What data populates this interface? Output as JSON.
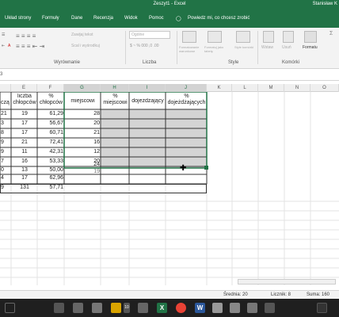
{
  "window": {
    "title": "Zeszyt1  -  Excel",
    "user": "Stanisław K"
  },
  "tabs": [
    "Układ strony",
    "Formuły",
    "Dane",
    "Recenzja",
    "Widok",
    "Pomoc"
  ],
  "tell_me": "Powiedz mi, co chcesz zrobić",
  "ribbon": {
    "wrap_text": "Zawijaj tekst",
    "merge_center": "Scal i wyśrodkuj",
    "number_format": "Ogólne",
    "conditional_formatting": "Formatowanie warunkowe",
    "format_as_table": "Formatuj jako tabelę",
    "cell_styles": "Style komórki",
    "insert": "Wstaw",
    "delete": "Usuń",
    "format": "Formatu",
    "groups": {
      "alignment": "Wyrównanie",
      "number": "Liczba",
      "styles": "Style",
      "cells": "Komórki"
    }
  },
  "name_box": "3",
  "columns": [
    "E",
    "F",
    "G",
    "H",
    "I",
    "J",
    "K",
    "L",
    "M",
    "N",
    "O"
  ],
  "header_row": {
    "c0": "czą",
    "e": "liczba chłopców",
    "f": "% chłopców",
    "g": "miejscowi",
    "h": "% miejscowi",
    "i": "dojeżdżający",
    "j": "% dojeżdżających"
  },
  "rows": [
    {
      "c0": "21",
      "e": "19",
      "f": "61,29",
      "g": "28"
    },
    {
      "c0": "3",
      "e": "17",
      "f": "56,67",
      "g": "20"
    },
    {
      "c0": "8",
      "e": "17",
      "f": "60,71",
      "g": "21"
    },
    {
      "c0": "9",
      "e": "21",
      "f": "72,41",
      "g": "16"
    },
    {
      "c0": "9",
      "e": "11",
      "f": "42,31",
      "g": "12"
    },
    {
      "c0": "7",
      "e": "16",
      "f": "53,33",
      "g": "20"
    },
    {
      "c0": "0",
      "e": "13",
      "f": "50,00",
      "g": "24"
    },
    {
      "c0": "4",
      "e": "17",
      "f": "62,96",
      "g": "19"
    },
    {
      "c0": "9",
      "e": "131",
      "f": "57,71",
      "g": ""
    }
  ],
  "status": {
    "average": "Średnia: 20",
    "count": "Licznik: 8",
    "sum": "Suma: 160"
  },
  "taskbar_badge": "10"
}
